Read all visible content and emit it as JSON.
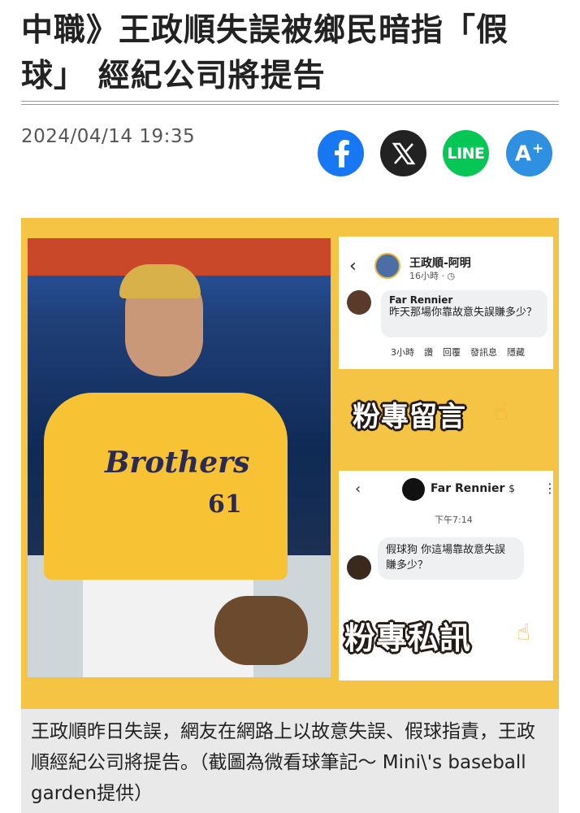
{
  "headline": "中職》王政順失誤被鄉民暗指「假球」 經紀公司將提告",
  "published": "2024/04/14 19:35",
  "share": {
    "facebook": {
      "label": "f",
      "icon": "facebook-icon",
      "color": "#1877f2"
    },
    "x": {
      "label": "𝕏",
      "icon": "x-icon",
      "color": "#222222"
    },
    "line": {
      "label": "LINE",
      "icon": "line-icon",
      "color": "#06c755"
    },
    "font_size": {
      "label": "A",
      "suffix": "+",
      "icon": "font-size-icon",
      "color": "#2f8fe0"
    }
  },
  "photo": {
    "jersey_brand": "Brothers",
    "jersey_number": "61",
    "comment_shot": {
      "page_name": "王政順-阿明",
      "meta": "16小時 · ◷",
      "commenter": "Far Rennier",
      "comment": "昨天那場你靠故意失誤賺多少？",
      "actions": [
        "3小時",
        "讚",
        "回覆",
        "發訊息",
        "隱藏"
      ]
    },
    "caption_comment": "粉專留言",
    "dm_shot": {
      "name": "Far Rennier",
      "badge": "$",
      "time": "下午7:14",
      "message": "假球狗 你這場靠故意失誤賺多少？"
    },
    "caption_dm": "粉專私訊"
  },
  "caption": "王政順昨日失誤，網友在網路上以故意失誤、假球指責，王政順經紀公司將提告。（截圖為微看球筆記～ Mini\\'s baseball garden提供）"
}
